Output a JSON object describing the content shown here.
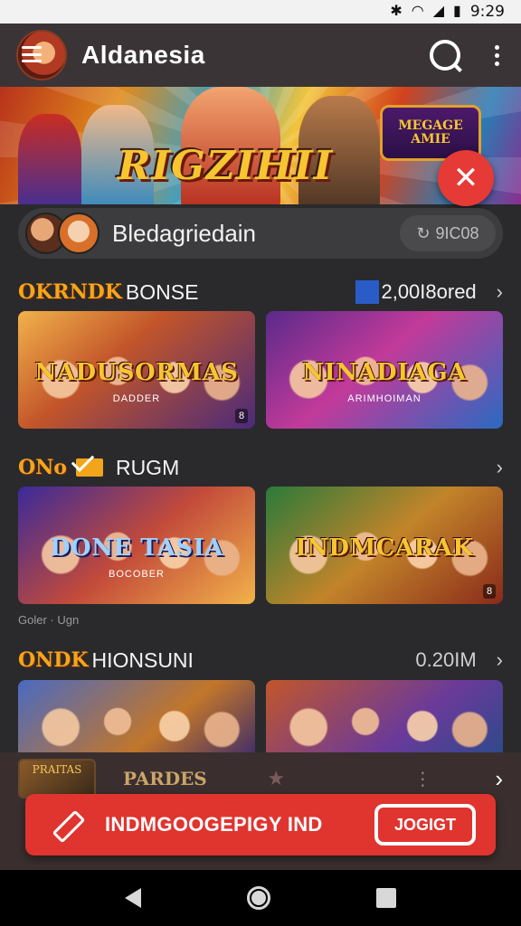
{
  "status_bar": {
    "time": "9:29",
    "icons": [
      "bluetooth-icon",
      "wifi-icon",
      "signal-icon",
      "battery-icon"
    ]
  },
  "app_bar": {
    "title": "Aldanesia",
    "icons": [
      "menu-icon",
      "search-icon",
      "more-vert-icon"
    ]
  },
  "hero": {
    "title": "RIGZIHII",
    "badge": "MEGAGE AMIE"
  },
  "profile": {
    "name": "Bledagriedain",
    "coins": "9IC08"
  },
  "sections": [
    {
      "tag": "OKRNDK",
      "name": "BONSE",
      "extra": "2,00I8ored",
      "tiles": [
        {
          "title": "NADUSORMAS",
          "subtitle": "DADDER",
          "corner": "8"
        },
        {
          "title": "NINADIAGA",
          "subtitle": "ARIMHOIMAN",
          "corner": ""
        }
      ]
    },
    {
      "tag": "ONo",
      "name": "RUGM",
      "extra": "",
      "tiles": [
        {
          "title": "DONE TASIA",
          "subtitle": "BOCOBER",
          "corner": ""
        },
        {
          "title": "INDMCARAK",
          "subtitle": "",
          "corner": "8"
        }
      ],
      "footnote": "Goler · Ugn"
    },
    {
      "tag": "ONDK",
      "name": "HIONSUNI",
      "extra": "0.20IM",
      "tiles": [
        {
          "title": "",
          "subtitle": "",
          "corner": ""
        },
        {
          "title": "",
          "subtitle": "",
          "corner": ""
        }
      ]
    }
  ],
  "dock": {
    "logo": "PRAITAS",
    "label": "PARDES"
  },
  "cta": {
    "label": "INDMGOOGEPIGY IND",
    "button": "JOGIGT"
  },
  "colors": {
    "accent": "#e0342f",
    "gold": "#f6c531",
    "app_bar": "#3a3436"
  }
}
